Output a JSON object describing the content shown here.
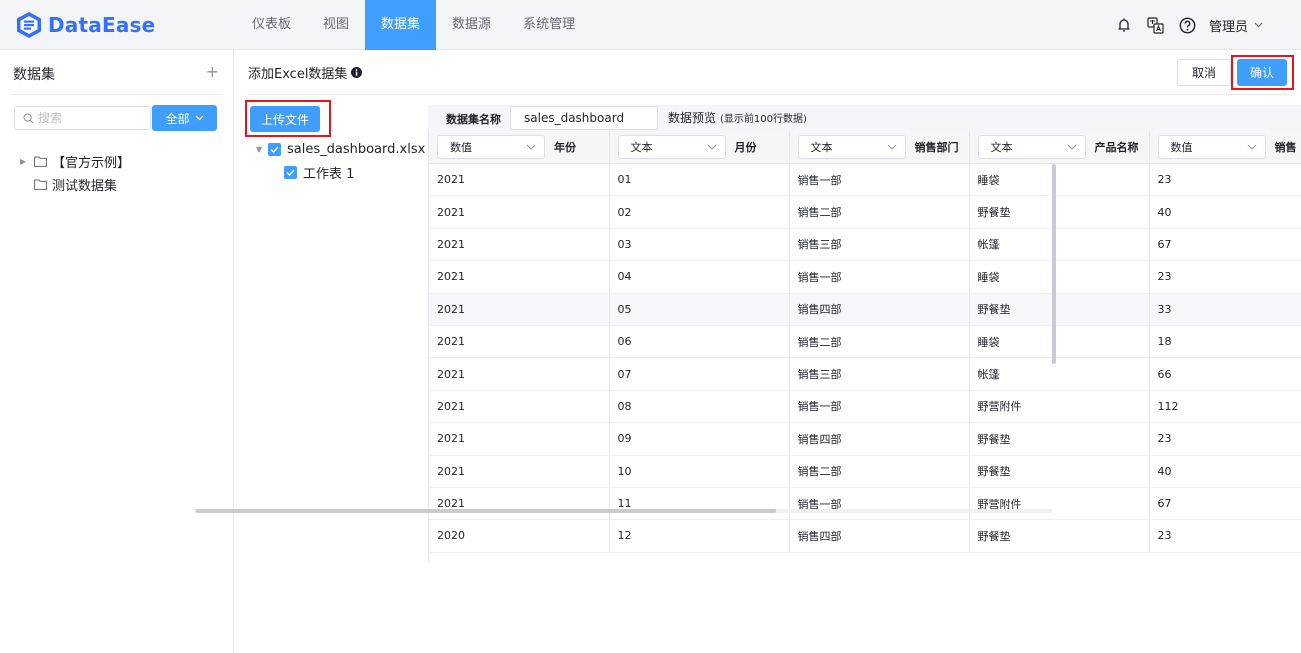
{
  "app": {
    "brand": "DataEase",
    "brand_color": "#3370ff",
    "accent": "#409eff"
  },
  "nav": {
    "items": [
      "仪表板",
      "视图",
      "数据集",
      "数据源",
      "系统管理"
    ],
    "active": "数据集"
  },
  "header": {
    "user": "管理员",
    "icons": [
      "notification-icon",
      "translate-icon",
      "help-icon"
    ]
  },
  "sidebar": {
    "title": "数据集",
    "search_placeholder": "搜索",
    "filter_label": "全部",
    "tree": [
      "【官方示例】",
      "测试数据集"
    ]
  },
  "main": {
    "title": "添加Excel数据集",
    "cancel_label": "取消",
    "confirm_label": "确认",
    "upload_label": "上传文件",
    "file_name": "sales_dashboard.xlsx",
    "sheet_name": "工作表 1"
  },
  "preview": {
    "dataset_name_label": "数据集名称",
    "dataset_name_value": "sales_dashboard",
    "title": "数据预览",
    "subtitle": "(显示前100行数据)",
    "columns": [
      {
        "type": "数值",
        "name": "年份"
      },
      {
        "type": "文本",
        "name": "月份"
      },
      {
        "type": "文本",
        "name": "销售部门"
      },
      {
        "type": "文本",
        "name": "产品名称"
      },
      {
        "type": "数值",
        "name": "销售"
      }
    ],
    "rows": [
      [
        "2021",
        "01",
        "销售一部",
        "睡袋",
        "23"
      ],
      [
        "2021",
        "02",
        "销售二部",
        "野餐垫",
        "40"
      ],
      [
        "2021",
        "03",
        "销售三部",
        "帐篷",
        "67"
      ],
      [
        "2021",
        "04",
        "销售一部",
        "睡袋",
        "23"
      ],
      [
        "2021",
        "05",
        "销售四部",
        "野餐垫",
        "33"
      ],
      [
        "2021",
        "06",
        "销售二部",
        "睡袋",
        "18"
      ],
      [
        "2021",
        "07",
        "销售三部",
        "帐篷",
        "66"
      ],
      [
        "2021",
        "08",
        "销售一部",
        "野营附件",
        "112"
      ],
      [
        "2021",
        "09",
        "销售四部",
        "野餐垫",
        "23"
      ],
      [
        "2021",
        "10",
        "销售二部",
        "野餐垫",
        "40"
      ],
      [
        "2021",
        "11",
        "销售一部",
        "野营附件",
        "67"
      ],
      [
        "2020",
        "12",
        "销售四部",
        "野餐垫",
        "23"
      ]
    ],
    "highlight_row": 4
  }
}
